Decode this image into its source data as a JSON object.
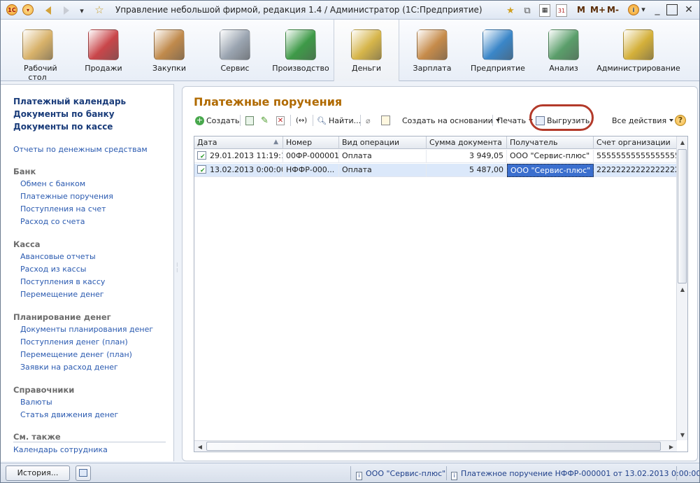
{
  "window": {
    "title": "Управление небольшой фирмой, редакция 1.4 / Администратор  (1С:Предприятие)",
    "title_buttons": [
      "M",
      "M+",
      "M-"
    ]
  },
  "sections": [
    {
      "label": "Рабочий стол",
      "icon": "desk-icon",
      "color": "#d8b26a"
    },
    {
      "label": "Продажи",
      "icon": "basket-icon",
      "color": "#c9464a"
    },
    {
      "label": "Закупки",
      "icon": "boxes-icon",
      "color": "#c08a4c"
    },
    {
      "label": "Сервис",
      "icon": "tools-icon",
      "color": "#9aa4b0"
    },
    {
      "label": "Производство",
      "icon": "factory-icon",
      "color": "#3e9a48"
    },
    {
      "label": "Деньги",
      "icon": "coins-icon",
      "color": "#d6b54a"
    },
    {
      "label": "Зарплата",
      "icon": "employee-icon",
      "color": "#c68b4a"
    },
    {
      "label": "Предприятие",
      "icon": "building-icon",
      "color": "#3a86c8"
    },
    {
      "label": "Анализ",
      "icon": "chart-icon",
      "color": "#5a9e6a"
    },
    {
      "label": "Администрирование",
      "icon": "database-icon",
      "color": "#d4b03a"
    }
  ],
  "active_section": "Деньги",
  "nav": {
    "main": [
      "Платежный календарь",
      "Документы по банку",
      "Документы по кассе"
    ],
    "reports": "Отчеты по денежным средствам",
    "groups": [
      {
        "title": "Банк",
        "items": [
          "Обмен с банком",
          "Платежные поручения",
          "Поступления на счет",
          "Расход со счета"
        ]
      },
      {
        "title": "Касса",
        "items": [
          "Авансовые отчеты",
          "Расход из кассы",
          "Поступления в кассу",
          "Перемещение денег"
        ]
      },
      {
        "title": "Планирование денег",
        "items": [
          "Документы планирования денег",
          "Поступления денег (план)",
          "Перемещение денег (план)",
          "Заявки на расход денег"
        ]
      },
      {
        "title": "Справочники",
        "items": [
          "Валюты",
          "Статья движения денег"
        ]
      }
    ],
    "see_also": {
      "title": "См. также",
      "items": [
        "Календарь сотрудника"
      ]
    }
  },
  "form": {
    "title": "Платежные поручения",
    "toolbar": {
      "create": "Создать",
      "find": "Найти...",
      "create_based": "Создать на основании",
      "print": "Печать",
      "export": "Выгрузить",
      "all_actions": "Все действия",
      "help": "?"
    },
    "columns": [
      "Дата",
      "Номер",
      "Вид операции",
      "Сумма документа",
      "Получатель",
      "Счет организации"
    ],
    "rows": [
      {
        "date": "29.01.2013 11:19:19",
        "number": "00ФР-000001",
        "op": "Оплата",
        "sum": "3 949,05",
        "recipient": "ООО \"Сервис-плюс\"",
        "account": "55555555555555555..."
      },
      {
        "date": "13.02.2013 0:00:00",
        "number": "НФФР-000...",
        "op": "Оплата",
        "sum": "5 487,00",
        "recipient": "ООО \"Сервис-плюс\"",
        "account": "22222222222222222..."
      }
    ],
    "selected_row": 1
  },
  "status": {
    "history": "История...",
    "items": [
      "ООО \"Сервис-плюс\"",
      "Платежное поручение НФФР-000001 от 13.02.2013 0:00:00"
    ]
  },
  "colors": {
    "accent_title": "#b06a00",
    "link": "#2a5ab0",
    "highlight_oval": "#b33a2a",
    "selection": "#dbe8fa"
  }
}
